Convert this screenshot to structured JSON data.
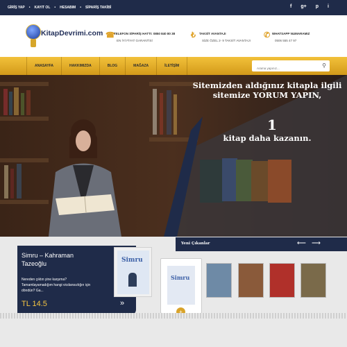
{
  "topbar": {
    "links": [
      "GİRİŞ YAP",
      "KAYIT OL",
      "HESABIM",
      "SİPARİŞ TAKİBİ"
    ],
    "separator": "•",
    "social": [
      "f",
      "g+",
      "p",
      "i"
    ]
  },
  "header": {
    "logo_text": "KitapDevrimi.com",
    "contact": [
      {
        "icon": "phone-icon",
        "glyph": "☎",
        "line1": "TELEFON SİPARİŞ HATTI: 0850 840 80 38",
        "line2": "EN İYİ FİYAT GARANTİSİ"
      },
      {
        "icon": "lira-icon",
        "glyph": "₺",
        "line1": "TAKSİT AVANTAJI",
        "line2": "SİZE ÖZEL 2- 9 TAKSİT AVANTAJI"
      },
      {
        "icon": "whatsapp-icon",
        "glyph": "✆",
        "line1": "WHATSAPP NUMARAMIZ",
        "line2": "0506 555 47 97"
      }
    ]
  },
  "nav": {
    "items": [
      "ANASAYFA",
      "HAKKIMIZDA",
      "BLOG",
      "MAĞAZA",
      "İLETİŞİM"
    ],
    "search_placeholder": "Arama yapınız..."
  },
  "hero": {
    "headline": "Sitemizden aldığınız kitapla ilgili sitemize YORUM YAPIN,",
    "number": "1",
    "subline": "kitap daha kazanın."
  },
  "featured": {
    "title": "Simru – Kahraman Tazeoğlu",
    "description": "Nereden çıktın yine karşıma? Tamamlayamadığım hangi vicdansızlığın için döndün? Ga...",
    "price": "TL 14.5",
    "cover_title": "Simru"
  },
  "new_releases": {
    "title": "Yeni Çıkanlar",
    "selected_cover": "Simru",
    "books": [
      {
        "color": "#6e8aa6"
      },
      {
        "color": "#8a5a3a"
      },
      {
        "color": "#b0302a"
      },
      {
        "color": "#7a6a4a"
      }
    ]
  },
  "colors": {
    "navy": "#1f2b49",
    "gold": "#e0a32a",
    "price": "#f5c542"
  }
}
